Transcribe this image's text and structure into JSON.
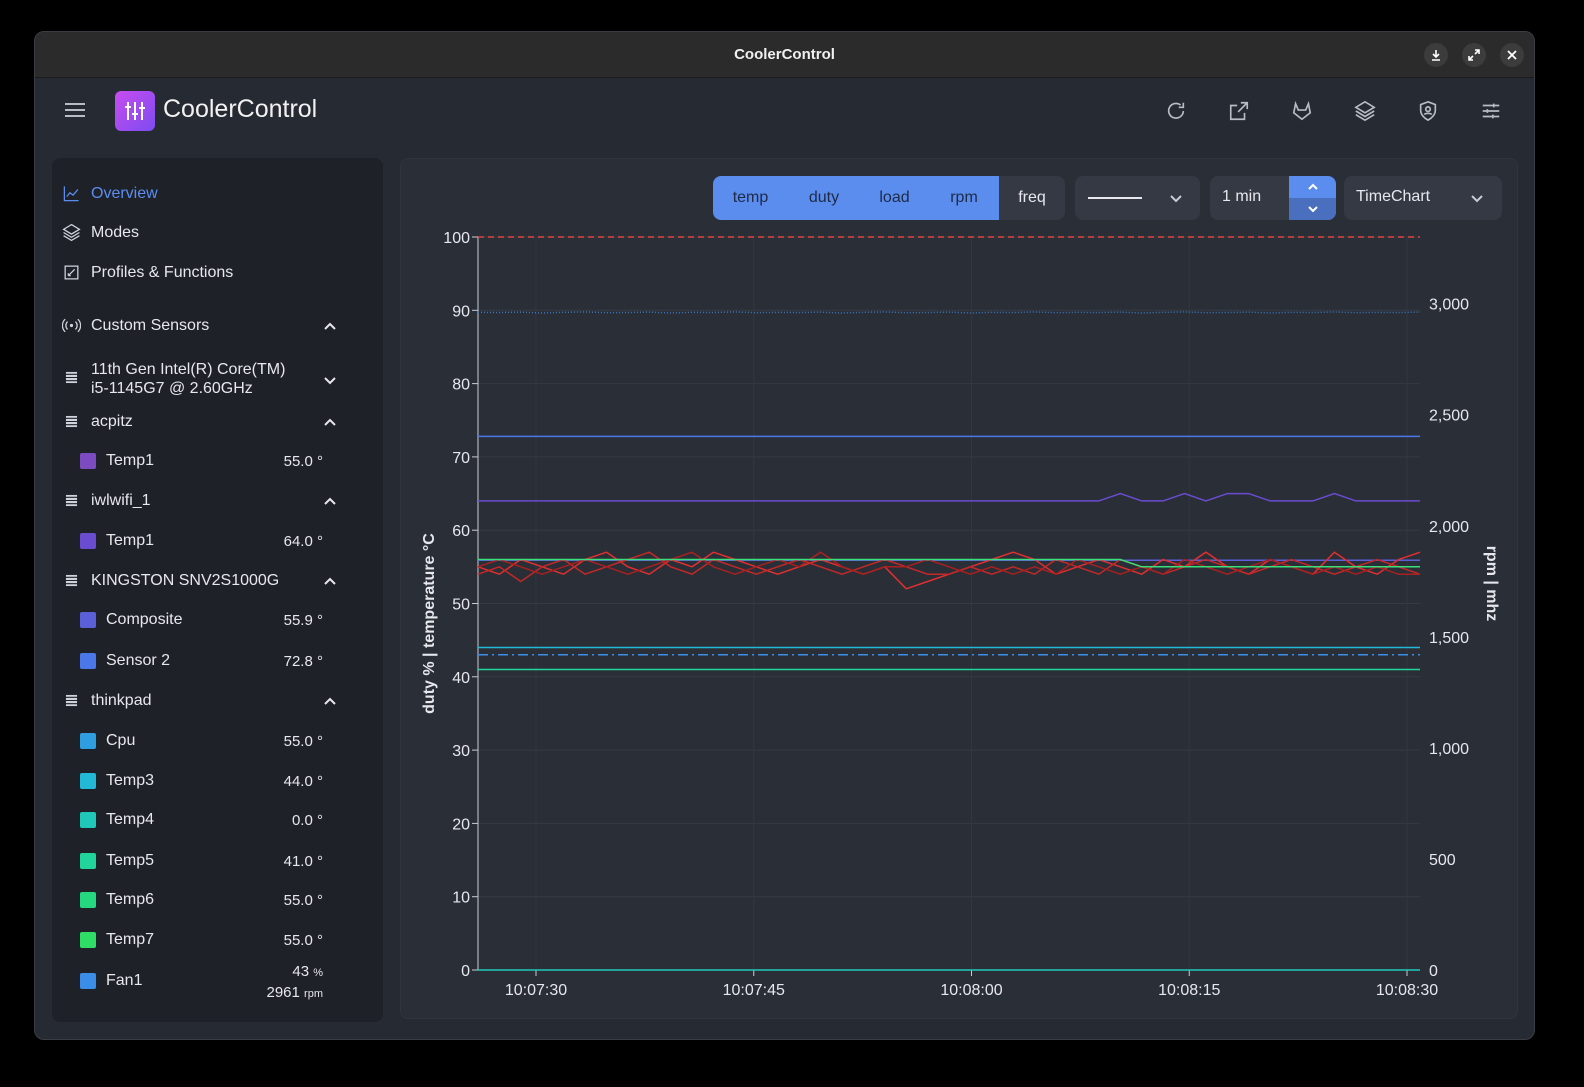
{
  "window": {
    "title": "CoolerControl"
  },
  "app": {
    "name": "CoolerControl"
  },
  "colors": {
    "accent": "#5b8def",
    "sidebar_bg": "#1e2127",
    "main_bg": "#2a2e37"
  },
  "top_icons": [
    "refresh-icon",
    "open-external-icon",
    "gitlab-icon",
    "layers-icon",
    "shield-icon",
    "settings-sliders-icon"
  ],
  "nav": [
    {
      "label": "Overview",
      "icon": "line-chart-icon",
      "active": true
    },
    {
      "label": "Modes",
      "icon": "layers-icon",
      "active": false
    },
    {
      "label": "Profiles & Functions",
      "icon": "edit-square-icon",
      "active": false
    }
  ],
  "groups": [
    {
      "label": "Custom Sensors",
      "icon": "broadcast-icon",
      "expanded": true
    },
    {
      "label_line1": "11th Gen Intel(R) Core(TM)",
      "label_line2": "i5-1145G7 @ 2.60GHz",
      "icon": "chip-icon",
      "expanded": false
    },
    {
      "label": "acpitz",
      "icon": "chip-icon",
      "expanded": true
    },
    {
      "label": "iwlwifi_1",
      "icon": "chip-icon",
      "expanded": true
    },
    {
      "label": "KINGSTON SNV2S1000G",
      "icon": "chip-icon",
      "expanded": true
    },
    {
      "label": "thinkpad",
      "icon": "chip-icon",
      "expanded": true
    }
  ],
  "sensors": {
    "acpitz": [
      {
        "name": "Temp1",
        "value": "55.0 °",
        "color": "#7b4bbf"
      }
    ],
    "iwlwifi_1": [
      {
        "name": "Temp1",
        "value": "64.0 °",
        "color": "#6a4cd0"
      }
    ],
    "kingston": [
      {
        "name": "Composite",
        "value": "55.9 °",
        "color": "#5b5fd8"
      },
      {
        "name": "Sensor 2",
        "value": "72.8 °",
        "color": "#4b78e8"
      }
    ],
    "thinkpad": [
      {
        "name": "Cpu",
        "value": "55.0 °",
        "color": "#2f9ee0"
      },
      {
        "name": "Temp3",
        "value": "44.0 °",
        "color": "#22b8d6"
      },
      {
        "name": "Temp4",
        "value": "0.0 °",
        "color": "#1fc8b8"
      },
      {
        "name": "Temp5",
        "value": "41.0 °",
        "color": "#20d49a"
      },
      {
        "name": "Temp6",
        "value": "55.0 °",
        "color": "#25d77e"
      },
      {
        "name": "Temp7",
        "value": "55.0 °",
        "color": "#2fdc66"
      }
    ],
    "fan": {
      "name": "Fan1",
      "duty": "43",
      "duty_unit": "%",
      "rpm": "2961",
      "rpm_unit": "rpm",
      "color": "#3b8ee8"
    }
  },
  "toolbar": {
    "filters": [
      {
        "label": "temp",
        "selected": true
      },
      {
        "label": "duty",
        "selected": true
      },
      {
        "label": "load",
        "selected": true
      },
      {
        "label": "rpm",
        "selected": true
      },
      {
        "label": "freq",
        "selected": false
      }
    ],
    "line_style": "solid",
    "time_range": "1 min",
    "chart_type": "TimeChart"
  },
  "chart_data": {
    "type": "line",
    "x_ticks": [
      "10:07:30",
      "10:07:45",
      "10:08:00",
      "10:08:15",
      "10:08:30"
    ],
    "y_left_ticks": [
      "100",
      "90",
      "80",
      "70",
      "60",
      "50",
      "40",
      "30",
      "20",
      "10",
      "0"
    ],
    "y_right_ticks": [
      "3,000",
      "2,500",
      "2,000",
      "1,500",
      "1,000",
      "500",
      "0"
    ],
    "ylabel_left": "duty %  |  temperature °C",
    "ylabel_right": "rpm  |  mhz",
    "ylim_left": [
      0,
      100
    ],
    "ylim_right": [
      0,
      3300
    ],
    "grid": true,
    "series": [
      {
        "color": "#e0453d",
        "style": "dashed",
        "axis": "left",
        "values": [
          100,
          100,
          100,
          100,
          100,
          100,
          100,
          100,
          100,
          100,
          100,
          100,
          100,
          100,
          100,
          100,
          100,
          100,
          100,
          100,
          100,
          100,
          100,
          100,
          100,
          100,
          100,
          100,
          100,
          100,
          100,
          100,
          100,
          100,
          100,
          100,
          100,
          100,
          100,
          100,
          100,
          100,
          100,
          100,
          100
        ]
      },
      {
        "color": "#3a78c0",
        "style": "dotted",
        "axis": "right",
        "values": [
          2961,
          2960,
          2962,
          2958,
          2961,
          2963,
          2959,
          2960,
          2962,
          2958,
          2961,
          2960,
          2963,
          2959,
          2961,
          2960,
          2962,
          2958,
          2961,
          2963,
          2959,
          2960,
          2962,
          2958,
          2961,
          2960,
          2963,
          2959,
          2961,
          2960,
          2962,
          2958,
          2961,
          2963,
          2959,
          2960,
          2962,
          2958,
          2961,
          2960,
          2963,
          2959,
          2961,
          2960,
          2962
        ]
      },
      {
        "color": "#4b78e8",
        "style": "solid",
        "axis": "left",
        "values": [
          72.8,
          72.8,
          72.8,
          72.8,
          72.8,
          72.8,
          72.8,
          72.8,
          72.8,
          72.8,
          72.8,
          72.8,
          72.8,
          72.8,
          72.8,
          72.8,
          72.8,
          72.8,
          72.8,
          72.8,
          72.8,
          72.8,
          72.8,
          72.8,
          72.8,
          72.8,
          72.8,
          72.8,
          72.8,
          72.8,
          72.8,
          72.8,
          72.8,
          72.8,
          72.8,
          72.8,
          72.8,
          72.8,
          72.8,
          72.8,
          72.8,
          72.8,
          72.8,
          72.8,
          72.8
        ]
      },
      {
        "color": "#6a4cd0",
        "style": "solid",
        "axis": "left",
        "values": [
          64,
          64,
          64,
          64,
          64,
          64,
          64,
          64,
          64,
          64,
          64,
          64,
          64,
          64,
          64,
          64,
          64,
          64,
          64,
          64,
          64,
          64,
          64,
          64,
          64,
          64,
          64,
          64,
          64,
          64,
          65,
          64,
          64,
          65,
          64,
          65,
          65,
          64,
          64,
          64,
          65,
          64,
          64,
          64,
          64
        ]
      },
      {
        "color": "#5b5fd8",
        "style": "solid",
        "axis": "left",
        "values": [
          55.9,
          55.9,
          55.9,
          55.9,
          55.9,
          55.9,
          55.9,
          55.9,
          55.9,
          55.9,
          55.9,
          55.9,
          55.9,
          55.9,
          55.9,
          55.9,
          55.9,
          55.9,
          55.9,
          55.9,
          55.9,
          55.9,
          55.9,
          55.9,
          55.9,
          55.9,
          55.9,
          55.9,
          55.9,
          55.9,
          55.9,
          55.9,
          55.9,
          55.9,
          55.9,
          55.9,
          55.9,
          55.9,
          55.9,
          55.9,
          55.9,
          55.9,
          55.9,
          55.9,
          55.9
        ]
      },
      {
        "color": "#e02f2f",
        "style": "solid",
        "axis": "left",
        "values": [
          55,
          54,
          56,
          55,
          54,
          56,
          57,
          55,
          54,
          56,
          55,
          57,
          56,
          55,
          54,
          55,
          56,
          55,
          54,
          55,
          52,
          53,
          54,
          55,
          56,
          57,
          56,
          54,
          55,
          56,
          55,
          54,
          56,
          55,
          57,
          55,
          54,
          56,
          55,
          54,
          57,
          55,
          54,
          56,
          57
        ]
      },
      {
        "color": "#c42828",
        "style": "solid",
        "axis": "left",
        "values": [
          54,
          55,
          53,
          55,
          56,
          54,
          55,
          56,
          57,
          55,
          54,
          56,
          55,
          54,
          55,
          56,
          55,
          54,
          55,
          56,
          55,
          54,
          54,
          55,
          54,
          55,
          54,
          56,
          55,
          54,
          56,
          55,
          54,
          55,
          56,
          55,
          54,
          55,
          56,
          55,
          54,
          55,
          56,
          55,
          54
        ]
      },
      {
        "color": "#a82020",
        "style": "solid",
        "axis": "left",
        "values": [
          55,
          56,
          55,
          54,
          55,
          56,
          55,
          54,
          55,
          56,
          57,
          55,
          54,
          55,
          56,
          55,
          57,
          55,
          54,
          55,
          55,
          56,
          55,
          54,
          55,
          54,
          55,
          54,
          56,
          55,
          54,
          55,
          54,
          56,
          55,
          54,
          55,
          56,
          55,
          54,
          55,
          54,
          55,
          54,
          54
        ]
      },
      {
        "color": "#39e07a",
        "style": "solid",
        "axis": "left",
        "values": [
          56,
          56,
          56,
          56,
          56,
          56,
          56,
          56,
          56,
          56,
          56,
          56,
          56,
          56,
          56,
          56,
          56,
          56,
          56,
          56,
          56,
          56,
          56,
          56,
          56,
          56,
          56,
          56,
          56,
          56,
          56,
          55,
          55,
          55,
          55,
          55,
          55,
          55,
          55,
          55,
          55,
          55,
          55,
          55,
          55
        ]
      },
      {
        "color": "#22b8d6",
        "style": "solid",
        "axis": "left",
        "values": [
          44,
          44,
          44,
          44,
          44,
          44,
          44,
          44,
          44,
          44,
          44,
          44,
          44,
          44,
          44,
          44,
          44,
          44,
          44,
          44,
          44,
          44,
          44,
          44,
          44,
          44,
          44,
          44,
          44,
          44,
          44,
          44,
          44,
          44,
          44,
          44,
          44,
          44,
          44,
          44,
          44,
          44,
          44,
          44,
          44
        ]
      },
      {
        "color": "#3b8ee8",
        "style": "dashdot",
        "axis": "left",
        "values": [
          43,
          43,
          43,
          43,
          43,
          43,
          43,
          43,
          43,
          43,
          43,
          43,
          43,
          43,
          43,
          43,
          43,
          43,
          43,
          43,
          43,
          43,
          43,
          43,
          43,
          43,
          43,
          43,
          43,
          43,
          43,
          43,
          43,
          43,
          43,
          43,
          43,
          43,
          43,
          43,
          43,
          43,
          43,
          43,
          43
        ]
      },
      {
        "color": "#20d49a",
        "style": "solid",
        "axis": "left",
        "values": [
          41,
          41,
          41,
          41,
          41,
          41,
          41,
          41,
          41,
          41,
          41,
          41,
          41,
          41,
          41,
          41,
          41,
          41,
          41,
          41,
          41,
          41,
          41,
          41,
          41,
          41,
          41,
          41,
          41,
          41,
          41,
          41,
          41,
          41,
          41,
          41,
          41,
          41,
          41,
          41,
          41,
          41,
          41,
          41,
          41
        ]
      },
      {
        "color": "#1fc8b8",
        "style": "solid",
        "axis": "left",
        "values": [
          0,
          0,
          0,
          0,
          0,
          0,
          0,
          0,
          0,
          0,
          0,
          0,
          0,
          0,
          0,
          0,
          0,
          0,
          0,
          0,
          0,
          0,
          0,
          0,
          0,
          0,
          0,
          0,
          0,
          0,
          0,
          0,
          0,
          0,
          0,
          0,
          0,
          0,
          0,
          0,
          0,
          0,
          0,
          0,
          0
        ]
      }
    ]
  }
}
